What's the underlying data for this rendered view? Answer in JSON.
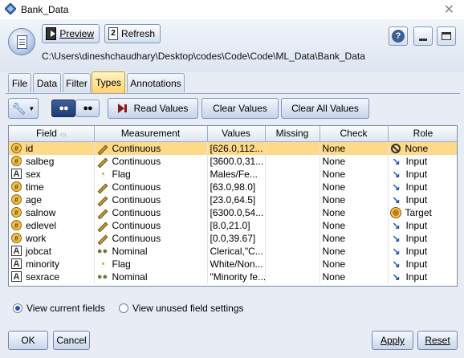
{
  "window": {
    "title": "Bank_Data",
    "close": "✕"
  },
  "header": {
    "preview_label": "Preview",
    "refresh_label": "Refresh",
    "path": "C:\\Users\\dineshchaudhary\\Desktop\\codes\\Code\\Code\\ML_Data\\Bank_Data",
    "help_label": "?"
  },
  "tabs": [
    {
      "label": "File"
    },
    {
      "label": "Data"
    },
    {
      "label": "Filter"
    },
    {
      "label": "Types",
      "active": true
    },
    {
      "label": "Annotations"
    }
  ],
  "toolbar": {
    "read_values": "Read Values",
    "clear_values": "Clear Values",
    "clear_all_values": "Clear All Values"
  },
  "table": {
    "columns": [
      "Field",
      "Measurement",
      "Values",
      "Missing",
      "Check",
      "Role"
    ],
    "rows": [
      {
        "field": "id",
        "ftype": "num",
        "measurement": "Continuous",
        "micon": "ruler",
        "values": "[626.0,112...",
        "missing": "",
        "check": "None",
        "role": "None",
        "ricon": "none",
        "selected": true
      },
      {
        "field": "salbeg",
        "ftype": "num",
        "measurement": "Continuous",
        "micon": "ruler",
        "values": "[3600.0,31...",
        "missing": "",
        "check": "None",
        "role": "Input",
        "ricon": "input"
      },
      {
        "field": "sex",
        "ftype": "str",
        "measurement": "Flag",
        "micon": "flag",
        "values": "Males/Fe...",
        "missing": "",
        "check": "None",
        "role": "Input",
        "ricon": "input"
      },
      {
        "field": "time",
        "ftype": "num",
        "measurement": "Continuous",
        "micon": "ruler",
        "values": "[63.0,98.0]",
        "missing": "",
        "check": "None",
        "role": "Input",
        "ricon": "input"
      },
      {
        "field": "age",
        "ftype": "num",
        "measurement": "Continuous",
        "micon": "ruler",
        "values": "[23.0,64.5]",
        "missing": "",
        "check": "None",
        "role": "Input",
        "ricon": "input"
      },
      {
        "field": "salnow",
        "ftype": "num",
        "measurement": "Continuous",
        "micon": "ruler",
        "values": "[6300.0,54...",
        "missing": "",
        "check": "None",
        "role": "Target",
        "ricon": "target"
      },
      {
        "field": "edlevel",
        "ftype": "num",
        "measurement": "Continuous",
        "micon": "ruler",
        "values": "[8.0,21.0]",
        "missing": "",
        "check": "None",
        "role": "Input",
        "ricon": "input"
      },
      {
        "field": "work",
        "ftype": "num",
        "measurement": "Continuous",
        "micon": "ruler",
        "values": "[0.0,39.67]",
        "missing": "",
        "check": "None",
        "role": "Input",
        "ricon": "input"
      },
      {
        "field": "jobcat",
        "ftype": "str",
        "measurement": "Nominal",
        "micon": "nominal",
        "values": "Clerical,\"C...",
        "missing": "",
        "check": "None",
        "role": "Input",
        "ricon": "input"
      },
      {
        "field": "minority",
        "ftype": "str",
        "measurement": "Flag",
        "micon": "flag",
        "values": "White/Non...",
        "missing": "",
        "check": "None",
        "role": "Input",
        "ricon": "input"
      },
      {
        "field": "sexrace",
        "ftype": "str",
        "measurement": "Nominal",
        "micon": "nominal",
        "values": "\"Minority fe...",
        "missing": "",
        "check": "None",
        "role": "Input",
        "ricon": "input"
      }
    ]
  },
  "view_options": {
    "current": "View current fields",
    "unused": "View unused field settings",
    "selected": "current"
  },
  "buttons": {
    "ok": "OK",
    "cancel": "Cancel",
    "apply": "Apply",
    "reset": "Reset"
  }
}
